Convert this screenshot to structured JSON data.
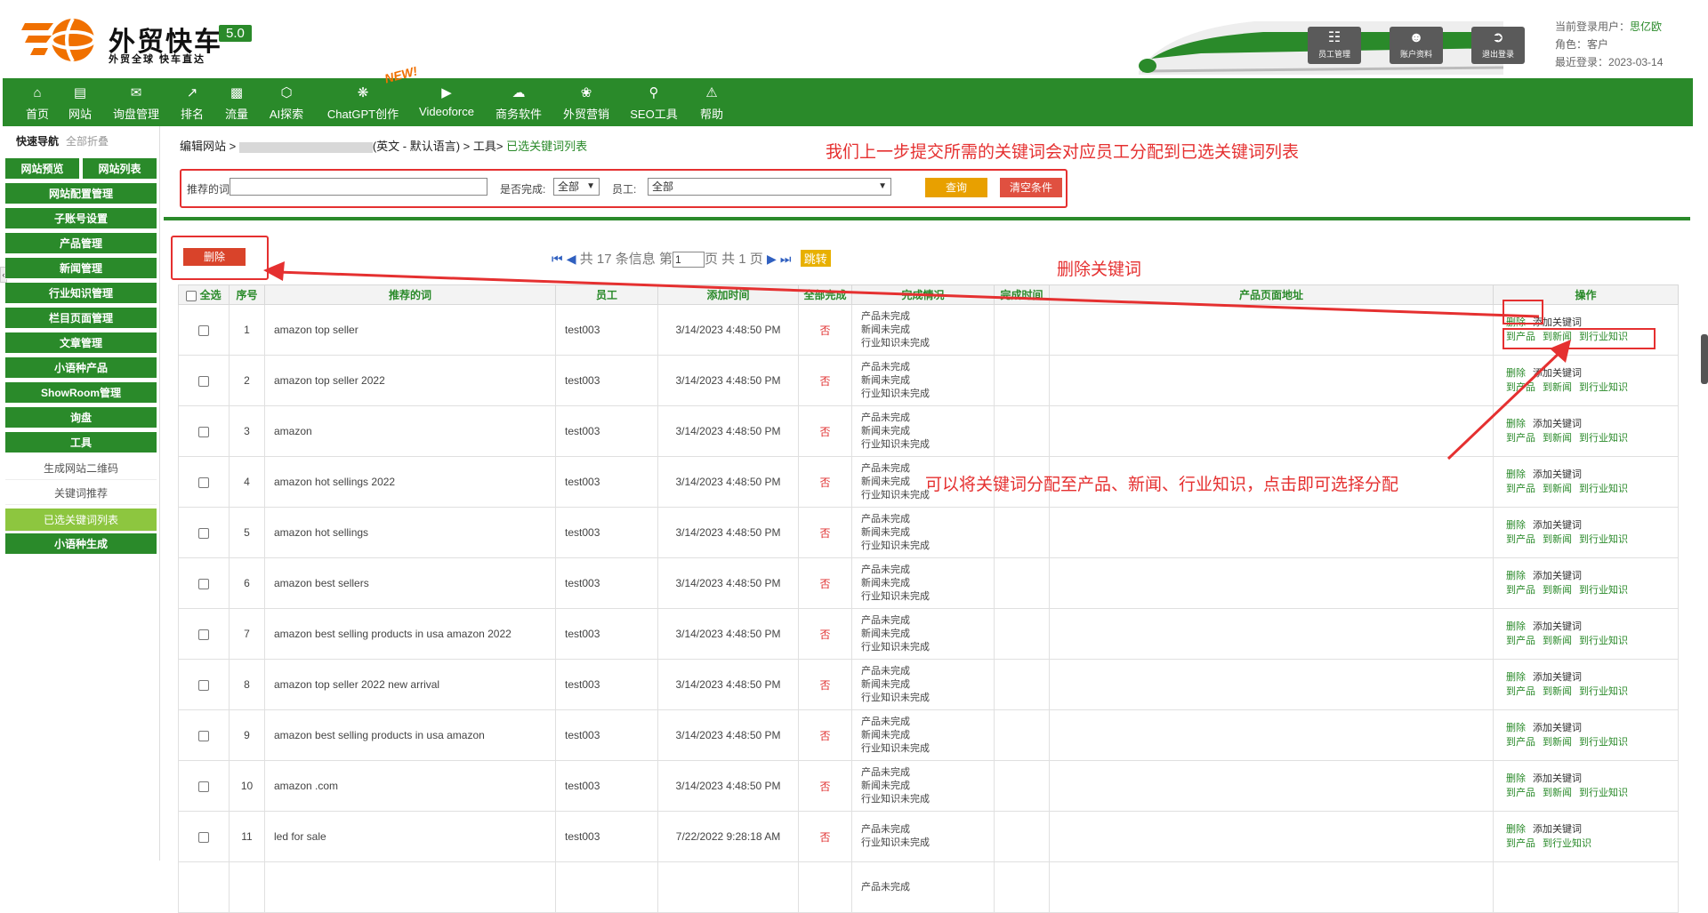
{
  "brand": {
    "name": "外贸快车",
    "version": "5.0",
    "slogan": "外贸全球 快车直达"
  },
  "header_buttons": [
    {
      "label": "员工管理",
      "icon": "staff-icon"
    },
    {
      "label": "账户资料",
      "icon": "account-icon"
    },
    {
      "label": "退出登录",
      "icon": "logout-icon"
    }
  ],
  "user": {
    "current_label": "当前登录用户：",
    "current_name": "思亿欧",
    "role_label": "角色：",
    "role": "客户",
    "last_label": "最近登录：",
    "last": "2023-03-14"
  },
  "nav": [
    {
      "label": "首页",
      "icon": "home-icon"
    },
    {
      "label": "网站",
      "icon": "monitor-icon"
    },
    {
      "label": "询盘管理",
      "icon": "mail-icon"
    },
    {
      "label": "排名",
      "icon": "ranking-icon"
    },
    {
      "label": "流量",
      "icon": "traffic-icon"
    },
    {
      "label": "AI探索",
      "icon": "ai-icon"
    },
    {
      "label": "ChatGPT创作",
      "icon": "chatgpt-icon"
    },
    {
      "label": "Videoforce",
      "icon": "video-icon"
    },
    {
      "label": "商务软件",
      "icon": "software-icon"
    },
    {
      "label": "外贸营销",
      "icon": "marketing-icon"
    },
    {
      "label": "SEO工具",
      "icon": "search-icon"
    },
    {
      "label": "帮助",
      "icon": "help-icon"
    }
  ],
  "nav_badge": "NEW!",
  "sidebar": {
    "title": "快速导航",
    "collapse": "全部折叠",
    "preview": "网站预览",
    "list": "网站列表",
    "items": [
      "网站配置管理",
      "子账号设置",
      "产品管理",
      "新闻管理",
      "行业知识管理",
      "栏目页面管理",
      "文章管理",
      "小语种产品",
      "ShowRoom管理",
      "询盘",
      "工具"
    ],
    "subitems": [
      "生成网站二维码",
      "关键词推荐",
      "已选关键词列表"
    ],
    "last": "小语种生成"
  },
  "breadcrumb": {
    "p1": "编辑网站 >",
    "p2": "(英文 - 默认语言) > 工具>",
    "current": "已选关键词列表"
  },
  "annotations": {
    "top": "我们上一步提交所需的关键词会对应员工分配到已选关键词列表",
    "delete": "删除关键词",
    "assign": "可以将关键词分配至产品、新闻、行业知识，点击即可选择分配"
  },
  "filter": {
    "keyword_label": "推荐的词",
    "done_label": "是否完成:",
    "done_value": "全部",
    "staff_label": "员工:",
    "staff_value": "全部",
    "query": "查询",
    "clear": "清空条件"
  },
  "delete_button": "删除",
  "pager": {
    "text1": "共 17 条信息 第",
    "page": "1",
    "text2": "页 共 1 页",
    "jump": "跳转"
  },
  "columns": [
    "全选",
    "序号",
    "推荐的词",
    "员工",
    "添加时间",
    "全部完成",
    "完成情况",
    "完成时间",
    "产品页面地址",
    "操作"
  ],
  "status3": [
    "产品未完成",
    "新闻未完成",
    "行业知识未完成"
  ],
  "status2": [
    "产品未完成",
    "行业知识未完成"
  ],
  "ops": {
    "del": "删除",
    "add": "添加关键词",
    "to_product": "到产品",
    "to_news": "到新闻",
    "to_industry": "到行业知识"
  },
  "rows": [
    {
      "no": "1",
      "kw": "amazon top seller",
      "staff": "test003",
      "time": "3/14/2023 4:48:50 PM",
      "done": "否"
    },
    {
      "no": "2",
      "kw": "amazon top seller 2022",
      "staff": "test003",
      "time": "3/14/2023 4:48:50 PM",
      "done": "否"
    },
    {
      "no": "3",
      "kw": "amazon",
      "staff": "test003",
      "time": "3/14/2023 4:48:50 PM",
      "done": "否"
    },
    {
      "no": "4",
      "kw": "amazon hot sellings 2022",
      "staff": "test003",
      "time": "3/14/2023 4:48:50 PM",
      "done": "否"
    },
    {
      "no": "5",
      "kw": "amazon hot sellings",
      "staff": "test003",
      "time": "3/14/2023 4:48:50 PM",
      "done": "否"
    },
    {
      "no": "6",
      "kw": "amazon best sellers",
      "staff": "test003",
      "time": "3/14/2023 4:48:50 PM",
      "done": "否"
    },
    {
      "no": "7",
      "kw": "amazon best selling products in usa amazon 2022",
      "staff": "test003",
      "time": "3/14/2023 4:48:50 PM",
      "done": "否"
    },
    {
      "no": "8",
      "kw": "amazon top seller 2022 new arrival",
      "staff": "test003",
      "time": "3/14/2023 4:48:50 PM",
      "done": "否"
    },
    {
      "no": "9",
      "kw": "amazon best selling products in usa amazon",
      "staff": "test003",
      "time": "3/14/2023 4:48:50 PM",
      "done": "否"
    },
    {
      "no": "10",
      "kw": "amazon .com",
      "staff": "test003",
      "time": "3/14/2023 4:48:50 PM",
      "done": "否"
    },
    {
      "no": "11",
      "kw": "led for sale",
      "staff": "test003",
      "time": "7/22/2022 9:28:18 AM",
      "done": "否"
    }
  ],
  "partial_row_status": "产品未完成",
  "colors": {
    "green": "#2a8a2a",
    "red": "#e53030",
    "light_green": "#8dc63f",
    "orange": "#e8a000"
  }
}
